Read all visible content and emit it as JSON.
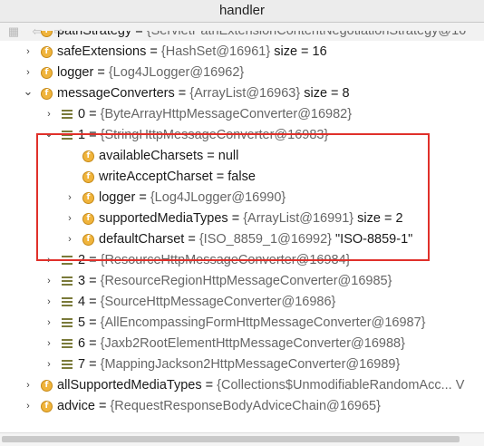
{
  "window": {
    "title": "handler"
  },
  "toolbar": {
    "buttons": [
      "collapse-all",
      "back",
      "forward"
    ]
  },
  "rows": [
    {
      "indent": 1,
      "arrow": "",
      "icon": "f",
      "name": "pathStrategy",
      "value": "{ServletPathExtensionContentNegotiationStrategy@16",
      "extra": ""
    },
    {
      "indent": 1,
      "arrow": "›",
      "icon": "f",
      "name": "safeExtensions",
      "value": "{HashSet@16961}",
      "extra": "size = 16"
    },
    {
      "indent": 1,
      "arrow": "›",
      "icon": "f",
      "name": "logger",
      "value": "{Log4JLogger@16962}",
      "extra": ""
    },
    {
      "indent": 1,
      "arrow": "⌄",
      "icon": "f",
      "name": "messageConverters",
      "value": "{ArrayList@16963}",
      "extra": "size = 8"
    },
    {
      "indent": 2,
      "arrow": "›",
      "icon": "e",
      "name": "0",
      "value": "{ByteArrayHttpMessageConverter@16982}",
      "extra": ""
    },
    {
      "indent": 2,
      "arrow": "⌄",
      "icon": "e",
      "name": "1",
      "value": "{StringHttpMessageConverter@16983}",
      "extra": ""
    },
    {
      "indent": 3,
      "arrow": "",
      "icon": "f",
      "name": "availableCharsets",
      "value": "",
      "extra": "null"
    },
    {
      "indent": 3,
      "arrow": "",
      "icon": "f",
      "name": "writeAcceptCharset",
      "value": "",
      "extra": "false"
    },
    {
      "indent": 3,
      "arrow": "›",
      "icon": "f",
      "name": "logger",
      "value": "{Log4JLogger@16990}",
      "extra": ""
    },
    {
      "indent": 3,
      "arrow": "›",
      "icon": "f",
      "name": "supportedMediaTypes",
      "value": "{ArrayList@16991}",
      "extra": "size = 2"
    },
    {
      "indent": 3,
      "arrow": "›",
      "icon": "f",
      "name": "defaultCharset",
      "value": "{ISO_8859_1@16992}",
      "extra": "\"ISO-8859-1\""
    },
    {
      "indent": 2,
      "arrow": "›",
      "icon": "e",
      "name": "2",
      "value": "{ResourceHttpMessageConverter@16984}",
      "extra": ""
    },
    {
      "indent": 2,
      "arrow": "›",
      "icon": "e",
      "name": "3",
      "value": "{ResourceRegionHttpMessageConverter@16985}",
      "extra": ""
    },
    {
      "indent": 2,
      "arrow": "›",
      "icon": "e",
      "name": "4",
      "value": "{SourceHttpMessageConverter@16986}",
      "extra": ""
    },
    {
      "indent": 2,
      "arrow": "›",
      "icon": "e",
      "name": "5",
      "value": "{AllEncompassingFormHttpMessageConverter@16987}",
      "extra": ""
    },
    {
      "indent": 2,
      "arrow": "›",
      "icon": "e",
      "name": "6",
      "value": "{Jaxb2RootElementHttpMessageConverter@16988}",
      "extra": ""
    },
    {
      "indent": 2,
      "arrow": "›",
      "icon": "e",
      "name": "7",
      "value": "{MappingJackson2HttpMessageConverter@16989}",
      "extra": ""
    },
    {
      "indent": 1,
      "arrow": "›",
      "icon": "f",
      "name": "allSupportedMediaTypes",
      "value": "{Collections$UnmodifiableRandomAcc... V",
      "extra": ""
    },
    {
      "indent": 1,
      "arrow": "›",
      "icon": "f",
      "name": "advice",
      "value": "{RequestResponseBodyAdviceChain@16965}",
      "extra": ""
    }
  ]
}
